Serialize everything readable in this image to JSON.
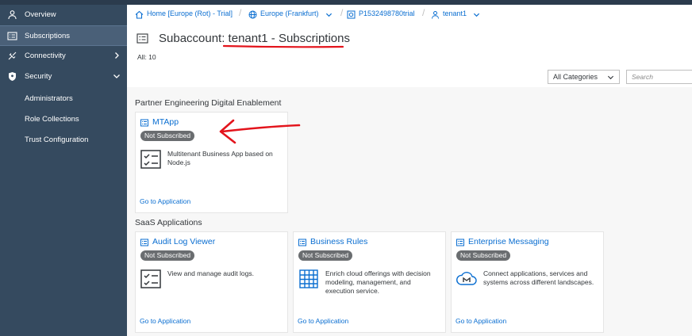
{
  "sidebar": {
    "items": [
      {
        "label": "Overview",
        "icon": "people-icon",
        "selected": false
      },
      {
        "label": "Subscriptions",
        "icon": "list-icon",
        "selected": true
      },
      {
        "label": "Connectivity",
        "icon": "connectivity-icon",
        "expander": "chevron-right"
      },
      {
        "label": "Security",
        "icon": "shield-icon",
        "expander": "chevron-down"
      }
    ],
    "security_subitems": [
      "Administrators",
      "Role Collections",
      "Trust Configuration"
    ]
  },
  "breadcrumb": {
    "home": "Home [Europe (Rot) - Trial]",
    "region": "Europe (Frankfurt)",
    "account": "P1532498780trial",
    "subaccount": "tenant1"
  },
  "header": {
    "title": "Subaccount: tenant1 - Subscriptions",
    "count": "All: 10"
  },
  "filter": {
    "category_selected": "All Categories",
    "search_placeholder": "Search"
  },
  "sections": [
    {
      "title": "Partner Engineering Digital Enablement",
      "tiles": [
        {
          "name": "MTApp",
          "status": "Not Subscribed",
          "description": "Multitenant Business App based on Node.js",
          "icon": "checklist-icon",
          "link": "Go to Application"
        }
      ]
    },
    {
      "title": "SaaS Applications",
      "tiles": [
        {
          "name": "Audit Log Viewer",
          "status": "Not Subscribed",
          "description": "View and manage audit logs.",
          "icon": "checklist-icon",
          "link": "Go to Application"
        },
        {
          "name": "Business Rules",
          "status": "Not Subscribed",
          "description": "Enrich cloud offerings with decision modeling, management, and execution service.",
          "icon": "grid-table-icon",
          "link": "Go to Application"
        },
        {
          "name": "Enterprise Messaging",
          "status": "Not Subscribed",
          "description": "Connect applications, services and systems across different landscapes.",
          "icon": "cloud-messaging-icon",
          "link": "Go to Application"
        }
      ]
    }
  ],
  "colors": {
    "sidebar_bg": "#354a5f",
    "link": "#0a6ed1",
    "badge_bg": "#6a6d70",
    "annotation": "#e3141c"
  }
}
